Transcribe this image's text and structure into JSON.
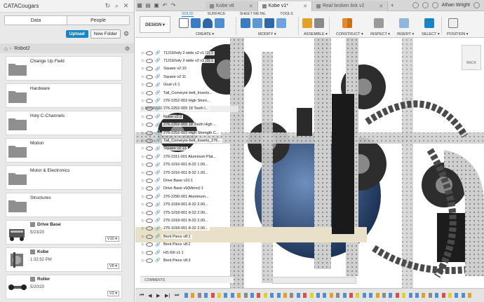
{
  "left_panel": {
    "team_name": "CATACougars",
    "tabs": [
      "Data",
      "People"
    ],
    "upload_label": "Upload",
    "new_folder_label": "New Folder",
    "breadcrumb": "Robot2",
    "folders": [
      "Change Up Field",
      "Hardware",
      "Holy C-Channels",
      "Motion",
      "Motor & Electronics",
      "Structures"
    ],
    "designs": [
      {
        "name": "Drive Base",
        "date": "5/23/20",
        "version": "V10 ▾"
      },
      {
        "name": "Kobe",
        "date": "1:32:52 PM",
        "version": "V8 ▾"
      },
      {
        "name": "Roller",
        "date": "5/20/20",
        "version": "V2 ▾"
      }
    ]
  },
  "topbar": {
    "tabs": [
      {
        "label": "Kobe v8",
        "active": false
      },
      {
        "label": "Kobe v1*",
        "active": true
      },
      {
        "label": "Real broken link v2",
        "active": false
      }
    ],
    "user": "Athan Wright"
  },
  "ribbon": {
    "tabs": [
      "SOLID",
      "SURFACE",
      "SHEET METAL",
      "TOOLS"
    ],
    "selected_tab": "SOLID",
    "workspace": "DESIGN ▾",
    "groups": [
      "CREATE ▾",
      "MODIFY ▾",
      "ASSEMBLE ▾",
      "CONSTRUCT ▾",
      "INSPECT ▾",
      "INSERT ▾",
      "SELECT ▾",
      "POSITION ▾"
    ]
  },
  "browser": {
    "header": "BROWSER",
    "rows": [
      "7121Eholy 2 wide v2 v1 (2):1",
      "7121Eholy 2 wide v2 v1 (3):1",
      "Square v2:10",
      "Square v2:11",
      "Goal v1:1",
      "Tall_Conveyor-belt_Inserts...",
      "276-2252-002 High Stren...",
      "276-2252-005 18 Tooth I...",
      "Roller v2:2",
      "276-2252-005 18 Tooth High ...",
      "276-2252-002 High Strength C...",
      "Tall_Conveyor-belt_Inserts_276...",
      "Square v2:13",
      "276-2311-001 Aluminum Plat...",
      "275-1016-001 8-32 1.00...",
      "275-1016-001 8-32 1.00...",
      "Drive Base v10:1",
      "Drive Base v9(Mirror):1",
      "276-2290-001 Aluminum...",
      "275-1018-001 8-32 2.00...",
      "275-1018-001 8-32 2.00...",
      "275-1018-001 8-32 2.00...",
      "275-1018-001 8-32 2.00...",
      "Bent Piece v8:1",
      "Bent Piece v8:2",
      "HS 60t v1:1",
      "Bent Piece v8:3"
    ]
  },
  "comments_label": "COMMENTS",
  "viewcube_label": "BACK"
}
